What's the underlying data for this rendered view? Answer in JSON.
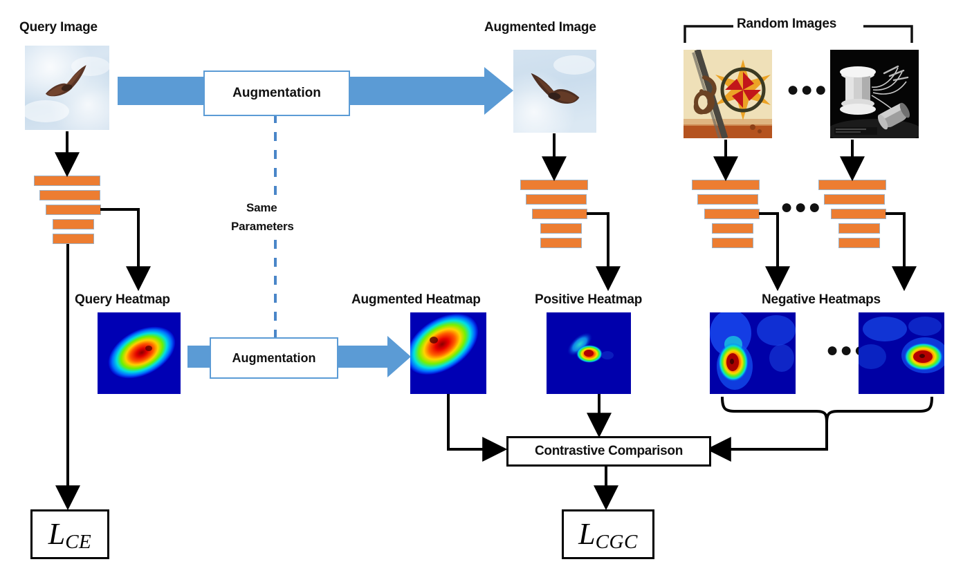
{
  "diagram": {
    "title": "Contrastive Grad-CAM Consistency training pipeline",
    "labels": {
      "query_image": "Query Image",
      "augmented_image": "Augmented Image",
      "random_images": "Random Images",
      "same_parameters_line1": "Same",
      "same_parameters_line2": "Parameters",
      "query_heatmap": "Query Heatmap",
      "augmented_heatmap": "Augmented Heatmap",
      "positive_heatmap": "Positive Heatmap",
      "negative_heatmaps": "Negative Heatmaps",
      "augmentation_top": "Augmentation",
      "augmentation_bottom": "Augmentation",
      "contrastive_comparison": "Contrastive Comparison",
      "ellipsis": "●●●"
    },
    "losses": [
      {
        "name": "cross-entropy-loss",
        "symbol": "L",
        "subscript": "CE"
      },
      {
        "name": "contrastive-grad-cam-loss",
        "symbol": "L",
        "subscript": "CGC"
      }
    ],
    "images": [
      {
        "name": "query-image",
        "content": "hawk flying in cloudy blue sky"
      },
      {
        "name": "augmented-image",
        "content": "hawk flying in cloudy blue sky, flipped and cropped"
      },
      {
        "name": "random-image-1",
        "content": "rope knot and red-orange painted star sign on wall"
      },
      {
        "name": "random-image-2",
        "content": "spool of thread with needles and thimble on black background"
      }
    ],
    "heatmaps": [
      {
        "name": "query-heatmap",
        "peak": "center, tilted ellipse"
      },
      {
        "name": "augmented-heatmap",
        "peak": "upper-left, tilted ellipse"
      },
      {
        "name": "positive-heatmap",
        "peak": "small center blob"
      },
      {
        "name": "negative-heatmap-1",
        "peak": "left vertical blob"
      },
      {
        "name": "negative-heatmap-2",
        "peak": "lower-right blob"
      }
    ],
    "colors": {
      "accent_blue": "#5B9BD5",
      "bar_orange": "#ED7D31",
      "bar_border": "#9BB0C4",
      "line_black": "#000000",
      "heatmap_low": "#0000b0",
      "heatmap_high": "#d80000"
    }
  }
}
